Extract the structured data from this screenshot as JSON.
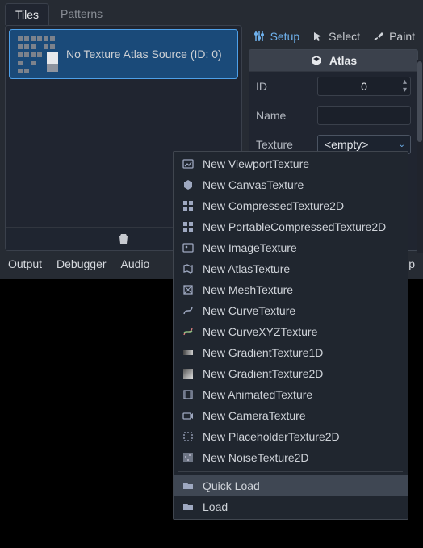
{
  "tabs": {
    "tiles": "Tiles",
    "patterns": "Patterns"
  },
  "source": {
    "label": "No Texture Atlas Source (ID: 0)"
  },
  "modes": {
    "setup": "Setup",
    "select": "Select",
    "paint": "Paint"
  },
  "inspector": {
    "header": "Atlas",
    "id_label": "ID",
    "id_value": "0",
    "name_label": "Name",
    "name_value": "",
    "texture_label": "Texture",
    "texture_value": "<empty>"
  },
  "bottom": {
    "output": "Output",
    "debugger": "Debugger",
    "audio": "Audio",
    "p": "p"
  },
  "menu": {
    "items": [
      "New ViewportTexture",
      "New CanvasTexture",
      "New CompressedTexture2D",
      "New PortableCompressedTexture2D",
      "New ImageTexture",
      "New AtlasTexture",
      "New MeshTexture",
      "New CurveTexture",
      "New CurveXYZTexture",
      "New GradientTexture1D",
      "New GradientTexture2D",
      "New AnimatedTexture",
      "New CameraTexture",
      "New PlaceholderTexture2D",
      "New NoiseTexture2D"
    ],
    "quick_load": "Quick Load",
    "load": "Load"
  }
}
